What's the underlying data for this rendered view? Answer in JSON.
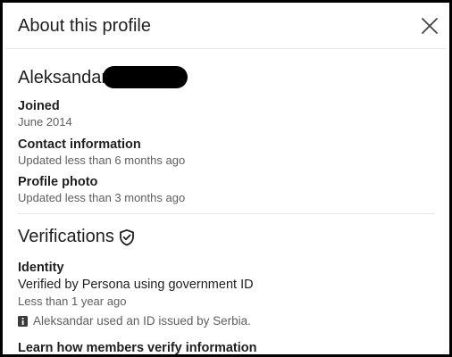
{
  "dialog": {
    "title": "About this profile",
    "close_icon": "close-icon"
  },
  "profile": {
    "name": "Aleksandar"
  },
  "items": [
    {
      "label": "Joined",
      "value": "June 2014"
    },
    {
      "label": "Contact information",
      "value": "Updated less than 6 months ago"
    },
    {
      "label": "Profile photo",
      "value": "Updated less than 3 months ago"
    }
  ],
  "verifications": {
    "title": "Verifications",
    "icon": "shield-check-icon",
    "identity_label": "Identity",
    "identity_value": "Verified by Persona using government ID",
    "identity_time": "Less than 1 year ago",
    "notice_icon": "info-icon",
    "notice": "Aleksandar used an ID issued by Serbia.",
    "learn_link": "Learn how members verify information"
  }
}
